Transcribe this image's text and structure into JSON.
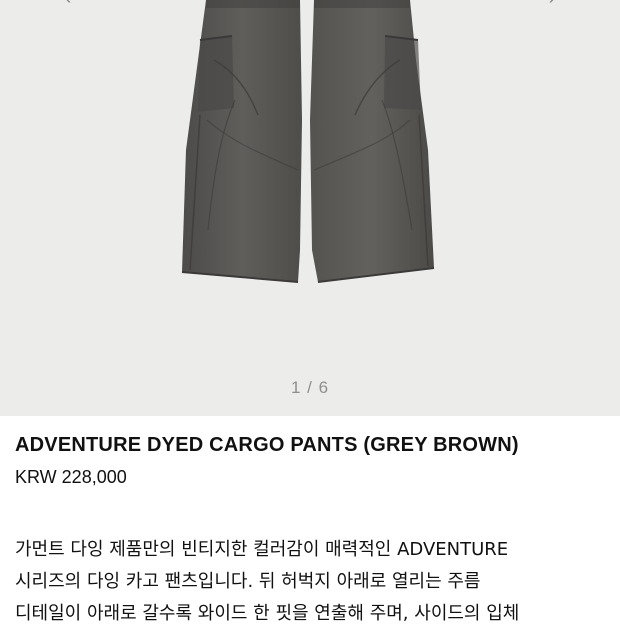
{
  "gallery": {
    "prev_icon": "chevron-left-icon",
    "next_icon": "chevron-right-icon",
    "prev_glyph": "‹",
    "next_glyph": "›",
    "pager": "1 / 6",
    "background": "#ececeb",
    "fabric_color": "#5a5855"
  },
  "product": {
    "title": "ADVENTURE DYED CARGO PANTS (GREY BROWN)",
    "price": "KRW 228,000",
    "description_lines": [
      "가먼트 다잉 제품만의 빈티지한 컬러감이 매력적인 ADVENTURE",
      "시리즈의 다잉 카고 팬츠입니다. 뒤 허벅지 아래로 열리는 주름",
      "디테일이 아래로 갈수록 와이드 한 핏을 연출해 주며, 사이드의 입체"
    ]
  }
}
